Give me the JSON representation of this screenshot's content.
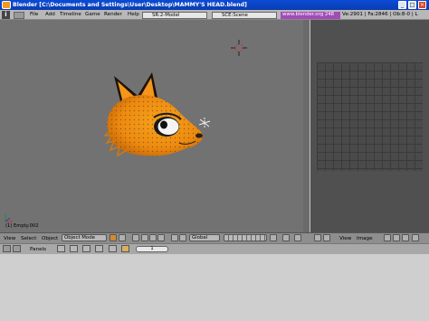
{
  "window": {
    "title": "Blender [C:\\Documents and Settings\\User\\Desktop\\MAMMY'S HEAD.blend]",
    "min_glyph": "_",
    "max_glyph": "□",
    "close_glyph": "×"
  },
  "menu": {
    "info_glyph": "i",
    "items": [
      "File",
      "Add",
      "Timeline",
      "Game",
      "Render",
      "Help"
    ],
    "screen_field": "SR:2-Model",
    "scene_field": "SCE:Scene",
    "url": "www.blender.org 248",
    "stats": "Ve:2901 | Fa:2846 | Ob:8-0 | L"
  },
  "viewport": {
    "object_label": "(1) Empty.002"
  },
  "header3d": {
    "items": [
      "View",
      "Select",
      "Object"
    ],
    "mode": "Object Mode",
    "orientation": "Global"
  },
  "header_image": {
    "items": [
      "View",
      "Image"
    ]
  },
  "buttons_window": {
    "panels_label": "Panels",
    "frame": "1"
  }
}
